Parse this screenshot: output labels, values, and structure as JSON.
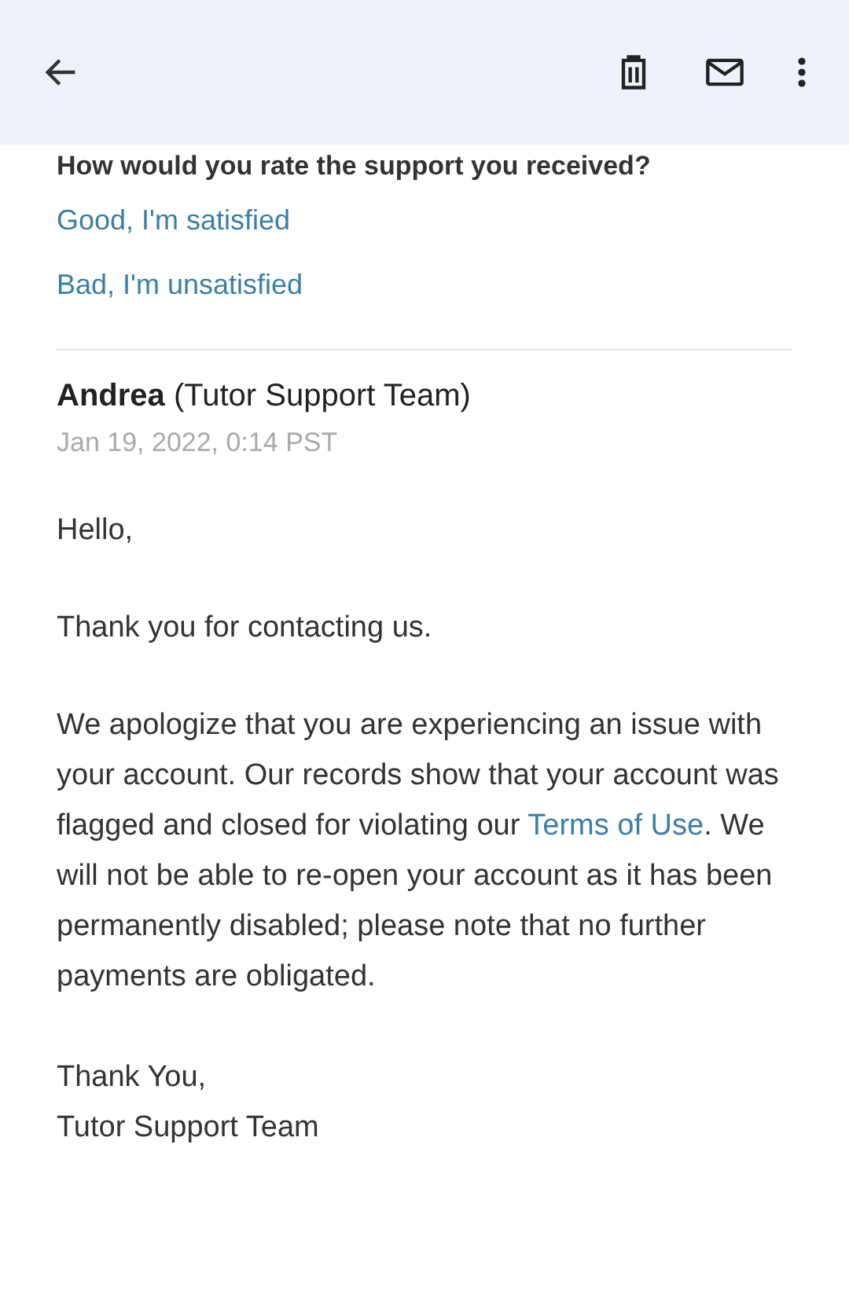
{
  "rating": {
    "question": "How would you rate the support you received?",
    "options": [
      "Good, I'm satisfied",
      "Bad, I'm unsatisfied"
    ]
  },
  "message": {
    "sender": "Andrea",
    "team": "(Tutor Support Team)",
    "date": "Jan 19, 2022, 0:14 PST",
    "greeting": "Hello,",
    "intro": "Thank you for contacting us.",
    "body_before": "We apologize that you are experiencing an issue with your account. Our records show that your account was flagged and closed for violating our ",
    "body_link": "Terms of Use",
    "body_after": ". We will not be able to re-open your account as it has been permanently disabled; please note that no further payments are obligated.",
    "signoff": [
      "Thank You,",
      "Tutor Support Team"
    ]
  }
}
